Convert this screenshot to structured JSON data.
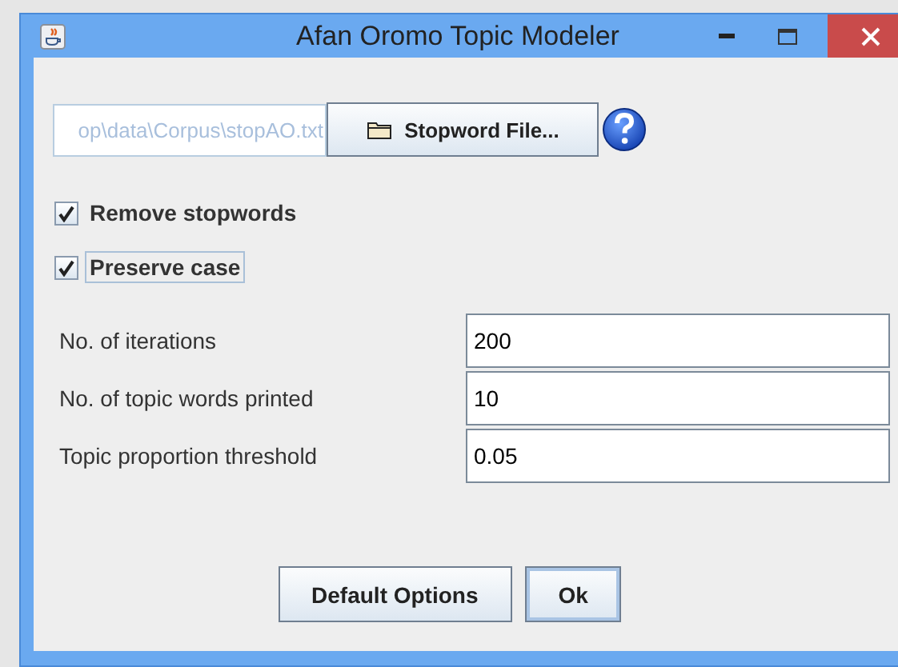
{
  "window": {
    "title": "Afan Oromo Topic Modeler"
  },
  "stopword_path": {
    "value": "op\\data\\Corpus\\stopAO.txt"
  },
  "stopword_button": {
    "label": "Stopword File..."
  },
  "options": [
    {
      "label": "Remove stopwords",
      "checked": true,
      "focused": false
    },
    {
      "label": "Preserve case",
      "checked": true,
      "focused": true
    }
  ],
  "settings": [
    {
      "label": "No. of iterations",
      "value": "200"
    },
    {
      "label": "No. of topic words printed",
      "value": "10"
    },
    {
      "label": "Topic proportion threshold",
      "value": "0.05"
    }
  ],
  "buttons": [
    {
      "label": "Default Options",
      "focused": false
    },
    {
      "label": "Ok",
      "focused": true
    }
  ]
}
